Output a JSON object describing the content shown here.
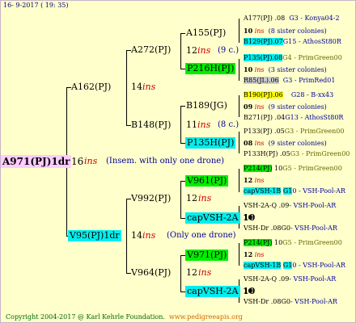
{
  "header": {
    "date": "16- 9-2017 ( 19: 35)"
  },
  "footer": {
    "copyright": "Copyright 2004-2017 @ Karl Kehrle Foundation.",
    "url": "www.pedigreeapis.org"
  },
  "colors": {
    "background": "#ffffcc",
    "root_bg": "#ffccff",
    "green": "#00ee00",
    "cyan": "#00eeee",
    "yellow": "#ffff00",
    "grey": "#cccccc",
    "ins_red": "#cc0000",
    "note_blue": "#000099"
  },
  "root": {
    "label": "A971(PJ)1dr",
    "count": "16",
    "ins": "ins",
    "note": "(Insem. with only one drone)"
  },
  "g1": [
    {
      "label": "A162(PJ)",
      "count": "14",
      "ins": "ins"
    },
    {
      "label": "V95(PJ)1dr",
      "count": "14",
      "ins": "ins",
      "note": "(Only one drone)"
    }
  ],
  "g2": [
    {
      "label": "A272(PJ)"
    },
    {
      "label": "B148(PJ)"
    },
    {
      "label": "V992(PJ)",
      "count": "12",
      "ins": "ins"
    },
    {
      "label": "V964(PJ)",
      "count": "12",
      "ins": "ins"
    }
  ],
  "g3": [
    {
      "label": "A155(PJ)",
      "count": "12",
      "ins": "ins",
      "note": "(9 c.)"
    },
    {
      "label": "P216H(PJ)"
    },
    {
      "label": "B189(JG)",
      "count": "11",
      "ins": "ins",
      "note": "(8 c.)"
    },
    {
      "label": "P135H(PJ)"
    },
    {
      "label": "V961(PJ)",
      "count": "12",
      "ins": "ins"
    },
    {
      "label": "capVSH-2A",
      "count": "10"
    },
    {
      "label": "V971(PJ)",
      "count": "12",
      "ins": "ins"
    },
    {
      "label": "capVSH-2A",
      "count": "10"
    }
  ],
  "g4": [
    {
      "label": "A177(PJ)",
      "num": ".08",
      "origin": "G3 - Konya04-2"
    },
    {
      "label": "10",
      "ins": "ins",
      "note": "(8 sister colonies)"
    },
    {
      "label": "B129(PJ)",
      "num": ".07",
      "origin": "G15 - AthosSt80R"
    },
    {
      "label": "P135(PJ)",
      "num": ".08",
      "origin": "G4 - PrimGreen00"
    },
    {
      "label": "10",
      "ins": "ins",
      "note": "(3 sister colonies)"
    },
    {
      "label": "R85(JL)",
      "num": ".06",
      "origin": "G3 - PrimRed01"
    },
    {
      "label": "B190(PJ)",
      "num": ".06",
      "origin": "G28 - B-xx43"
    },
    {
      "label": "09",
      "ins": "ins",
      "note": "(9 sister colonies)"
    },
    {
      "label": "B271(PJ)",
      "num": ".04",
      "origin": "G13 - AthosSt80R"
    },
    {
      "label": "P133(PJ)",
      "num": ".05",
      "origin": "G3 - PrimGreen00"
    },
    {
      "label": "08",
      "ins": "ins",
      "note": "(9 sister colonies)"
    },
    {
      "label": "P133H(PJ)",
      "num": ".05",
      "origin": "G3 - PrimGreen00"
    },
    {
      "label": "P214(PJ)",
      "num": "10",
      "origin": "G5 - PrimGreen00"
    },
    {
      "label": "12",
      "ins": "ins"
    },
    {
      "label": "capVSH-1B",
      "num": "G1",
      "origin": "0 - VSH-Pool-AR"
    },
    {
      "label": "VSH-2A-Q",
      "num": ".09",
      "origin": "- VSH-Pool-AR"
    },
    {
      "label": "10"
    },
    {
      "label": "VSH-Dr",
      "num": ".08G0",
      "origin": "- VSH-Pool-AR"
    },
    {
      "label": "P214(PJ)",
      "num": "10",
      "origin": "G5 - PrimGreen00"
    },
    {
      "label": "12",
      "ins": "ins"
    },
    {
      "label": "capVSH-1B",
      "num": "G1",
      "origin": "0 - VSH-Pool-AR"
    },
    {
      "label": "VSH-2A-Q",
      "num": ".09",
      "origin": "- VSH-Pool-AR"
    },
    {
      "label": "10"
    },
    {
      "label": "VSH-Dr",
      "num": ".08G0",
      "origin": "- VSH-Pool-AR"
    }
  ]
}
